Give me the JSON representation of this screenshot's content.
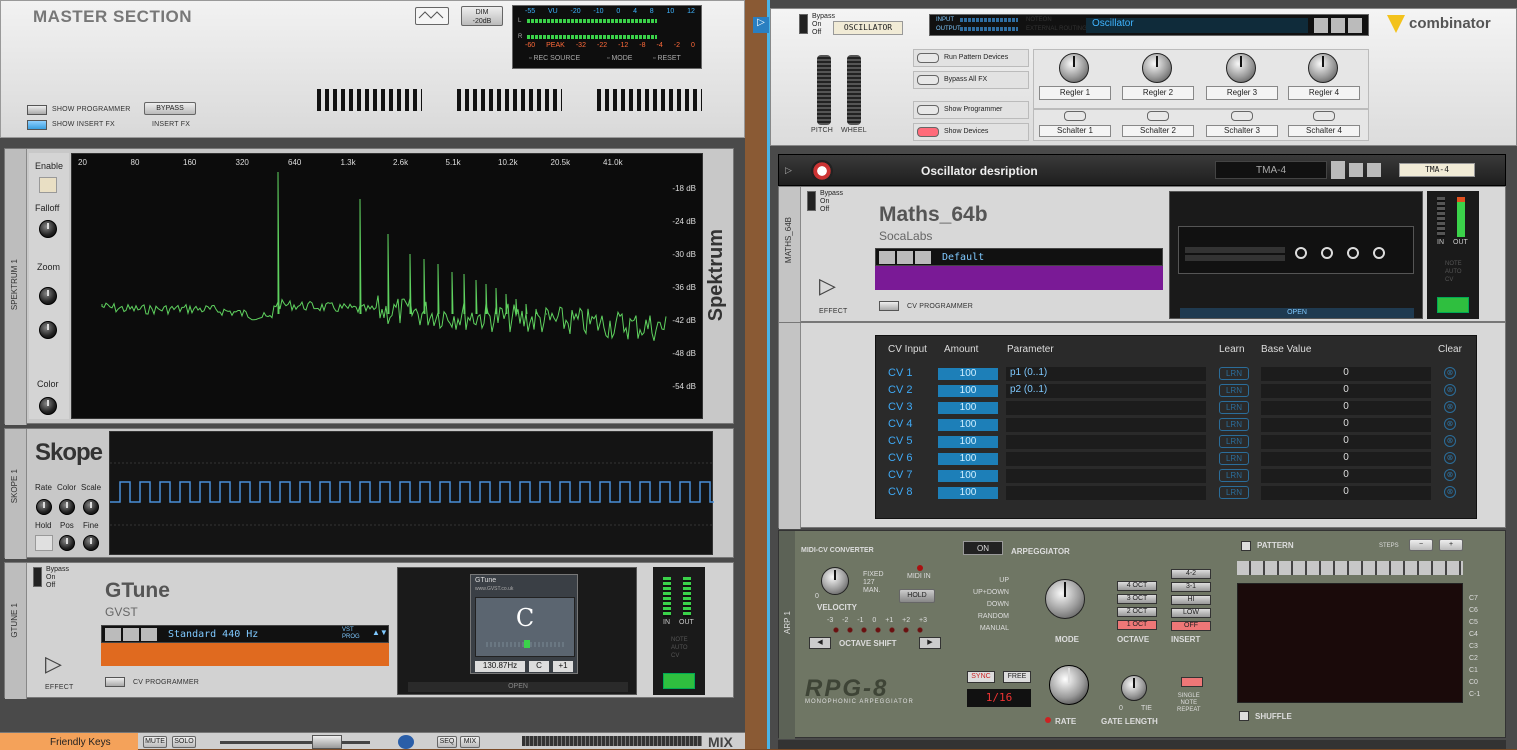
{
  "master": {
    "title": "MASTER SECTION",
    "dim_label": "DIM\n-20dB",
    "vu_top_scale": [
      "-55",
      "VU",
      "-20",
      "-10",
      "0",
      "4",
      "8",
      "10",
      "12"
    ],
    "vu_bottom_scale": [
      "-60",
      "PEAK",
      "-32",
      "-22",
      "-12",
      "-8",
      "-4",
      "-2",
      "0"
    ],
    "rec_source": "REC SOURCE",
    "mode": "MODE",
    "reset": "RESET",
    "show_programmer": "SHOW PROGRAMMER",
    "show_insert_fx": "SHOW INSERT FX",
    "bypass": "BYPASS",
    "insert_fx": "INSERT FX"
  },
  "spektrum": {
    "side_label": "SPEKTRUM 1",
    "enable": "Enable",
    "falloff": "Falloff",
    "zoom": "Zoom",
    "color": "Color",
    "brand": "Spektrum",
    "freq_ticks": [
      "20",
      "80",
      "160",
      "320",
      "640",
      "1.3k",
      "2.6k",
      "5.1k",
      "10.2k",
      "20.5k",
      "41.0k"
    ],
    "db_ticks": [
      "-18 dB",
      "-24 dB",
      "-30 dB",
      "-36 dB",
      "-42 dB",
      "-48 dB",
      "-54 dB"
    ]
  },
  "skope": {
    "side_label": "SKOPE 1",
    "brand": "Skope",
    "rate": "Rate",
    "color": "Color",
    "scale": "Scale",
    "hold": "Hold",
    "pos": "Pos",
    "fine": "Fine"
  },
  "gtune": {
    "side_label": "GTUNE 1",
    "bypass": "Bypass",
    "on": "On",
    "off": "Off",
    "name": "GTune",
    "vendor": "GVST",
    "preset": "Standard 440 Hz",
    "vst_prog": "VST\nPROG",
    "effect": "EFFECT",
    "cv_programmer": "CV PROGRAMMER",
    "plugin_title": "GTune",
    "plugin_url": "www.GVST.co.uk",
    "note": "C",
    "freq": "130.87Hz",
    "note_small": "C",
    "offset": "+1",
    "open": "OPEN",
    "in": "IN",
    "out": "OUT",
    "note_lbl": "NOTE",
    "auto_lbl": "AUTO",
    "cv_lbl": "CV"
  },
  "bottom_strip": {
    "device": "Friendly Keys",
    "mute": "MUTE",
    "solo": "SOLO",
    "seq": "SEQ",
    "mix": "MIX",
    "mix_big": "MIX"
  },
  "combinator": {
    "bypass": "Bypass",
    "on": "On",
    "off": "Off",
    "tape_name": "OSCILLATOR",
    "input": "INPUT",
    "output": "OUTPUT",
    "noteon": "NOTEON",
    "ext_routing": "EXTERNAL ROUTING",
    "patch_name": "Oscillator",
    "brand": "combinator",
    "run_pattern": "Run Pattern Devices",
    "bypass_all": "Bypass All FX",
    "show_programmer": "Show Programmer",
    "show_devices": "Show Devices",
    "pitch": "PITCH",
    "wheel": "WHEEL",
    "regler": [
      "Regler 1",
      "Regler 2",
      "Regler 3",
      "Regler 4"
    ],
    "schalter": [
      "Schalter 1",
      "Schalter 2",
      "Schalter 3",
      "Schalter 4"
    ]
  },
  "oscdesc": {
    "title": "Oscillator desription",
    "preset": "TMA-4",
    "tape": "TMA-4"
  },
  "maths": {
    "side_label": "MATHS_64B",
    "bypass": "Bypass",
    "on": "On",
    "off": "Off",
    "name": "Maths_64b",
    "vendor": "SocaLabs",
    "preset": "Default",
    "effect": "EFFECT",
    "cv_programmer": "CV PROGRAMMER",
    "open": "OPEN",
    "in": "IN",
    "out": "OUT",
    "note_lbl": "NOTE",
    "auto_lbl": "AUTO",
    "cv_lbl": "CV"
  },
  "cv_table": {
    "headers": [
      "CV Input",
      "Amount",
      "Parameter",
      "Learn",
      "Base Value",
      "Clear"
    ],
    "rows": [
      {
        "cv": "CV 1",
        "amount": "100",
        "param": "p1 (0..1)",
        "learn": "LRN",
        "base": "0"
      },
      {
        "cv": "CV 2",
        "amount": "100",
        "param": "p2 (0..1)",
        "learn": "LRN",
        "base": "0"
      },
      {
        "cv": "CV 3",
        "amount": "100",
        "param": "",
        "learn": "LRN",
        "base": "0"
      },
      {
        "cv": "CV 4",
        "amount": "100",
        "param": "",
        "learn": "LRN",
        "base": "0"
      },
      {
        "cv": "CV 5",
        "amount": "100",
        "param": "",
        "learn": "LRN",
        "base": "0"
      },
      {
        "cv": "CV 6",
        "amount": "100",
        "param": "",
        "learn": "LRN",
        "base": "0"
      },
      {
        "cv": "CV 7",
        "amount": "100",
        "param": "",
        "learn": "LRN",
        "base": "0"
      },
      {
        "cv": "CV 8",
        "amount": "100",
        "param": "",
        "learn": "LRN",
        "base": "0"
      }
    ]
  },
  "rpg8": {
    "side_label": "ARP 1",
    "midi_cv": "MIDI-CV CONVERTER",
    "fixed": "FIXED\n127\nMAN.",
    "velocity": "VELOCITY",
    "vel0": "0",
    "midi_in": "MIDI IN",
    "hold": "HOLD",
    "octave_shift_vals": [
      "-3",
      "-2",
      "-1",
      "0",
      "+1",
      "+2",
      "+3"
    ],
    "octave_shift": "OCTAVE SHIFT",
    "on": "ON",
    "arpeggiator": "ARPEGGIATOR",
    "modes": [
      "UP",
      "UP+DOWN",
      "DOWN",
      "RANDOM",
      "MANUAL"
    ],
    "mode": "MODE",
    "octaves": [
      "4 OCT",
      "3 OCT",
      "2 OCT",
      "1 OCT"
    ],
    "octave": "OCTAVE",
    "inserts": [
      "4-2",
      "3-1",
      "HI",
      "LOW",
      "OFF"
    ],
    "insert": "INSERT",
    "sync": "SYNC",
    "free": "FREE",
    "rate_val": "1/16",
    "rate": "RATE",
    "tie": "TIE",
    "gate0": "0",
    "gate_length": "GATE LENGTH",
    "single_note": "SINGLE\nNOTE\nREPEAT",
    "logo": "RPG-8",
    "sub_logo": "MONOPHONIC ARPEGGIATOR",
    "pattern": "PATTERN",
    "steps": "STEPS",
    "minus": "−",
    "plus": "+",
    "notes": [
      "C7",
      "C6",
      "C5",
      "C4",
      "C3",
      "C2",
      "C1",
      "C0",
      "C-1"
    ],
    "shuffle": "SHUFFLE"
  }
}
